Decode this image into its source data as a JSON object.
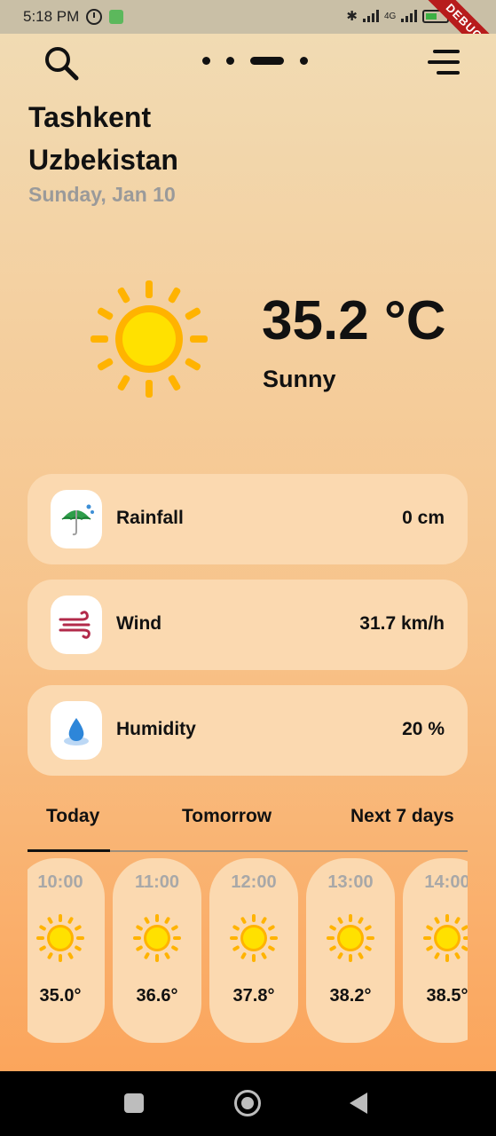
{
  "status_bar": {
    "time": "5:18 PM",
    "network": "4G",
    "battery": "46",
    "debug_label": "DEBUG"
  },
  "header": {
    "city": "Tashkent",
    "country": "Uzbekistan",
    "date": "Sunday, Jan 10"
  },
  "current": {
    "temperature": "35.2 °C",
    "condition": "Sunny",
    "icon": "sun-icon"
  },
  "stats": [
    {
      "label": "Rainfall",
      "value": "0 cm",
      "icon": "umbrella-rain-icon"
    },
    {
      "label": "Wind",
      "value": "31.7 km/h",
      "icon": "wind-icon"
    },
    {
      "label": "Humidity",
      "value": "20 %",
      "icon": "water-drop-icon"
    }
  ],
  "tabs": [
    {
      "label": "Today",
      "active": true
    },
    {
      "label": "Tomorrow",
      "active": false
    },
    {
      "label": "Next 7 days",
      "active": false
    }
  ],
  "hourly": [
    {
      "time": "10:00",
      "temp": "35.0°"
    },
    {
      "time": "11:00",
      "temp": "36.6°"
    },
    {
      "time": "12:00",
      "temp": "37.8°"
    },
    {
      "time": "13:00",
      "temp": "38.2°"
    },
    {
      "time": "14:00",
      "temp": "38.5°"
    }
  ],
  "colors": {
    "accent_sun": "#ffd000",
    "card": "#fbd9b0",
    "debug_ribbon": "#b71c1c"
  }
}
